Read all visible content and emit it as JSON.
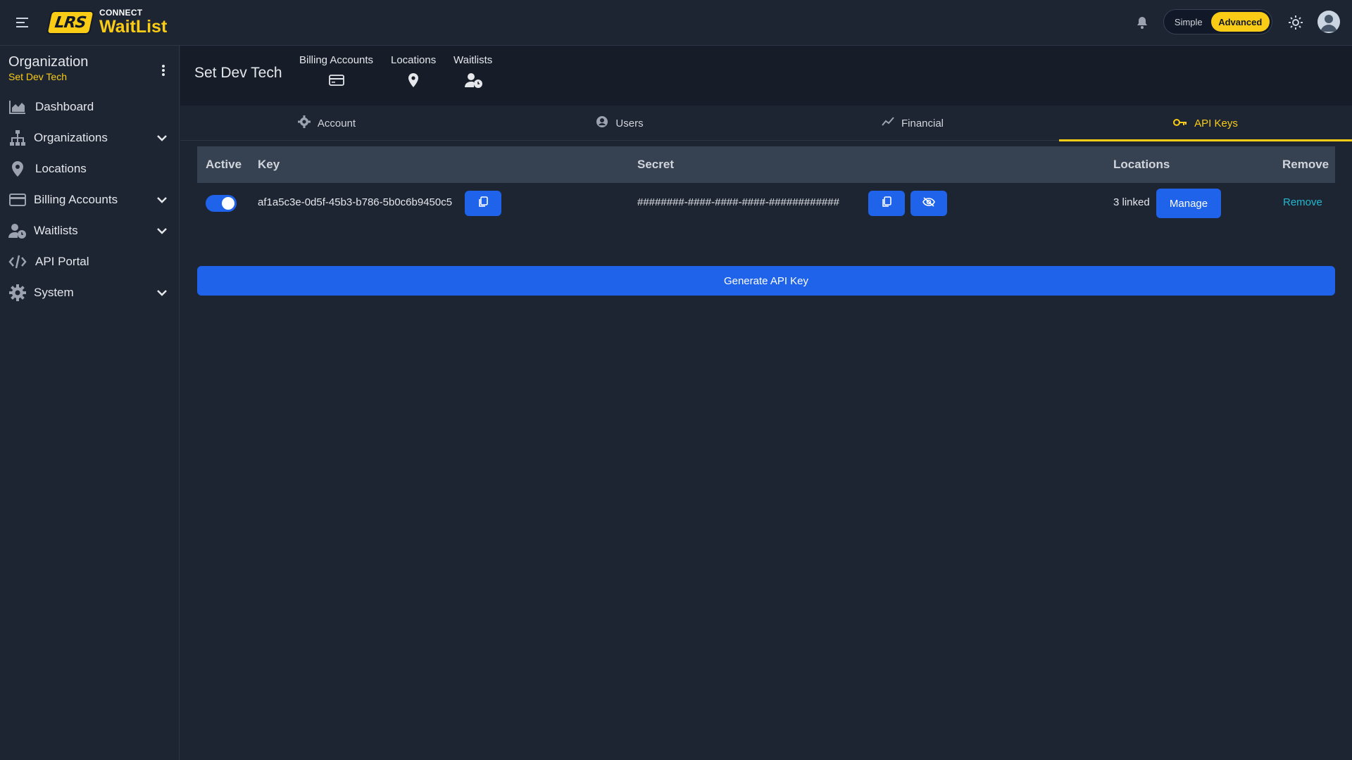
{
  "app": {
    "logo_badge": "LRS",
    "logo_connect": "CONNECT",
    "logo_name": "WaitList"
  },
  "topbar": {
    "mode_simple": "Simple",
    "mode_advanced": "Advanced",
    "active_mode": "Advanced"
  },
  "sidebar": {
    "org_title": "Organization",
    "org_name": "Set Dev Tech",
    "items": [
      {
        "label": "Dashboard",
        "icon": "chart-area-icon",
        "expandable": false
      },
      {
        "label": "Organizations",
        "icon": "sitemap-icon",
        "expandable": true
      },
      {
        "label": "Locations",
        "icon": "map-pin-icon",
        "expandable": false
      },
      {
        "label": "Billing Accounts",
        "icon": "credit-card-icon",
        "expandable": true
      },
      {
        "label": "Waitlists",
        "icon": "user-clock-icon",
        "expandable": true
      },
      {
        "label": "API Portal",
        "icon": "code-icon",
        "expandable": false
      },
      {
        "label": "System",
        "icon": "gear-icon",
        "expandable": true
      }
    ]
  },
  "header": {
    "entity_name": "Set Dev Tech",
    "quick_links": [
      {
        "label": "Billing Accounts",
        "icon": "credit-card-icon"
      },
      {
        "label": "Locations",
        "icon": "map-pin-icon"
      },
      {
        "label": "Waitlists",
        "icon": "user-clock-icon"
      }
    ]
  },
  "tabs": [
    {
      "label": "Account",
      "icon": "gear-icon",
      "active": false
    },
    {
      "label": "Users",
      "icon": "user-circle-icon",
      "active": false
    },
    {
      "label": "Financial",
      "icon": "trend-line-icon",
      "active": false
    },
    {
      "label": "API Keys",
      "icon": "key-icon",
      "active": true
    }
  ],
  "colors": {
    "accent": "#facc15",
    "primary": "#1e63e9",
    "link": "#22b8cf",
    "background": "#1d2533"
  },
  "api_keys": {
    "columns": {
      "active": "Active",
      "key": "Key",
      "secret": "Secret",
      "locations": "Locations",
      "remove": "Remove"
    },
    "rows": [
      {
        "active": true,
        "key": "af1a5c3e-0d5f-45b3-b786-5b0c6b9450c5",
        "secret": "########-####-####-####-############",
        "locations": "3 linked",
        "manage_label": "Manage",
        "remove_label": "Remove"
      }
    ],
    "generate_label": "Generate API Key"
  }
}
